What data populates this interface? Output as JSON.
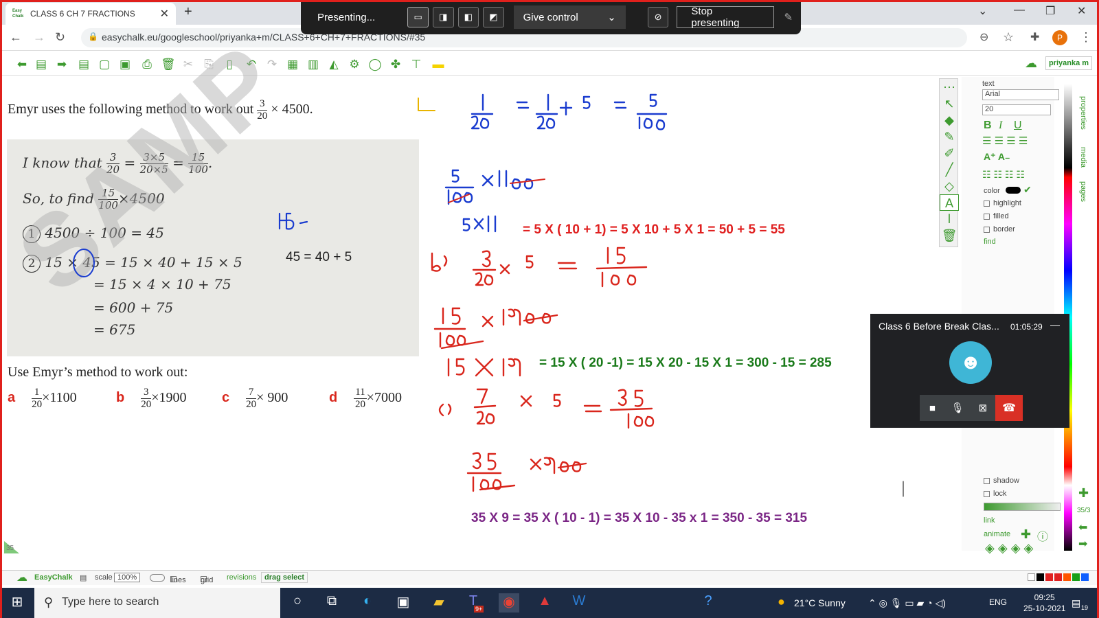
{
  "browser": {
    "tab_title": "CLASS 6 CH 7 FRACTIONS",
    "favicon_text": "Easy Chalk",
    "url": "easychalk.eu/googleschool/priyanka+m/CLASS+6+CH+7+FRACTIONS/#35",
    "profile_initial": "P"
  },
  "presenting_bar": {
    "status": "Presenting...",
    "give_control": "Give control",
    "stop": "Stop presenting"
  },
  "toolbar": {
    "user": "priyanka m"
  },
  "textbook": {
    "question": "Emyr uses the following method to work out",
    "question_frac": {
      "n": "3",
      "d": "20"
    },
    "question_tail": "× 4500.",
    "line1_prefix": "I know that",
    "line1_f1": {
      "n": "3",
      "d": "20"
    },
    "line1_f2": {
      "n": "3×5",
      "d": "20×5"
    },
    "line1_f3": {
      "n": "15",
      "d": "100"
    },
    "line2_prefix": "So, to find",
    "line2_frac": {
      "n": "15",
      "d": "100"
    },
    "line2_tail": "×4500",
    "step1": "4500 ÷ 100 = 45",
    "step2": "15 × 45 = 15 × 40 + 15 × 5",
    "step3": "= 15 × 4 × 10 + 75",
    "step4": "= 600 + 75",
    "step5": "= 675",
    "step1_num": "1",
    "step2_num": "2",
    "watermark": "SAMP",
    "use_label": "Use Emyr’s method to work out:",
    "parts": [
      {
        "letter": "a",
        "n": "1",
        "d": "20",
        "tail": "×1100"
      },
      {
        "letter": "b",
        "n": "3",
        "d": "20",
        "tail": "×1900"
      },
      {
        "letter": "c",
        "n": "7",
        "d": "20",
        "tail": "× 900"
      },
      {
        "letter": "d",
        "n": "11",
        "d": "20",
        "tail": "×7000"
      }
    ]
  },
  "typed": {
    "t1": "45 = 40 + 5",
    "t2": "=  5 X ( 10 + 1)   = 5 X 10 + 5 X 1  = 50 + 5 = 55",
    "t3": "= 15 X ( 20 -1) = 15 X 20  - 15 X 1 = 300 - 15 = 285",
    "t4": "35 X 9 =   35 X  ( 10 - 1) = 35 X 10 - 35 x 1 = 350 - 35 = 315"
  },
  "handwriting": {
    "h1": "45",
    "h2": "1/20 = 1/20 × 5 = 5/100",
    "h3": "5/100 × 1100",
    "h4": "5×11",
    "h5": "b) 3/20 × 5 = 15/100",
    "h6": "15/100 × 1900",
    "h7": "15 × 19",
    "h8": "c) 7/20 × 5 = 35/100",
    "h9": "35/100 × 900"
  },
  "properties": {
    "header": "text",
    "font": "Arial",
    "size": "20",
    "color_label": "color",
    "highlight": "highlight",
    "filled": "filled",
    "border": "border",
    "find": "find",
    "shadow": "shadow",
    "lock": "lock",
    "link": "link",
    "animate": "animate",
    "tabs": [
      "properties",
      "media",
      "pages"
    ],
    "page_counter": "35/3"
  },
  "meet": {
    "title": "Class 6 Before Break Clas...",
    "time": "01:05:29"
  },
  "appbar": {
    "brand": "EasyChalk",
    "scale_label": "scale",
    "scale_value": "100%",
    "lines": "lines",
    "grid": "grid",
    "revisions": "revisions",
    "drag_select": "drag select",
    "page_no": "35"
  },
  "taskbar": {
    "search_placeholder": "Type here to search",
    "weather": "21°C  Sunny",
    "lang": "ENG",
    "time": "09:25",
    "date": "25-10-2021",
    "teams_badge": "9+",
    "notif": "19"
  },
  "colors": {
    "accent_green": "#3d9a2f",
    "ink_blue": "#1a3ccf",
    "ink_red": "#d9261c",
    "typed_red": "#e02020",
    "typed_green": "#1a7a1a",
    "typed_purple": "#7a2585",
    "frame_red": "#e0201c"
  }
}
